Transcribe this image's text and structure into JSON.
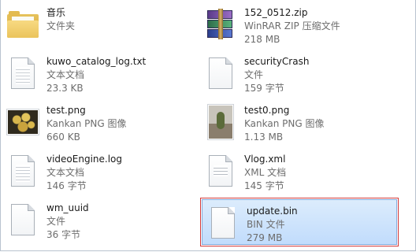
{
  "files": [
    {
      "name": "音乐",
      "line1": "文件夹",
      "line2": "",
      "icon": "folder-icon"
    },
    {
      "name": "152_0512.zip",
      "line1": "WinRAR ZIP 压缩文件",
      "line2": "218 MB",
      "icon": "winrar-archive-icon"
    },
    {
      "name": "kuwo_catalog_log.txt",
      "line1": "文本文档",
      "line2": "23.3 KB",
      "icon": "text-document-icon"
    },
    {
      "name": "securityCrash",
      "line1": "文件",
      "line2": "159 字节",
      "icon": "blank-file-icon"
    },
    {
      "name": "test.png",
      "line1": "Kankan PNG 图像",
      "line2": "660 KB",
      "icon": "image-thumbnail-icon"
    },
    {
      "name": "test0.png",
      "line1": "Kankan PNG 图像",
      "line2": "1.13 MB",
      "icon": "image-thumbnail-icon"
    },
    {
      "name": "videoEngine.log",
      "line1": "文本文档",
      "line2": "146 字节",
      "icon": "text-document-icon"
    },
    {
      "name": "Vlog.xml",
      "line1": "XML 文档",
      "line2": "145 字节",
      "icon": "xml-document-icon"
    },
    {
      "name": "wm_uuid",
      "line1": "文件",
      "line2": "36 字节",
      "icon": "blank-file-icon"
    },
    {
      "name": "update.bin",
      "line1": "BIN 文件",
      "line2": "279 MB",
      "icon": "blank-file-icon",
      "selected": true
    }
  ],
  "colors": {
    "selection_fill": "#c9e0fb",
    "selection_border": "#84acdd",
    "highlight_outline": "#d23a3a",
    "secondary_text": "#6d6d6d"
  }
}
